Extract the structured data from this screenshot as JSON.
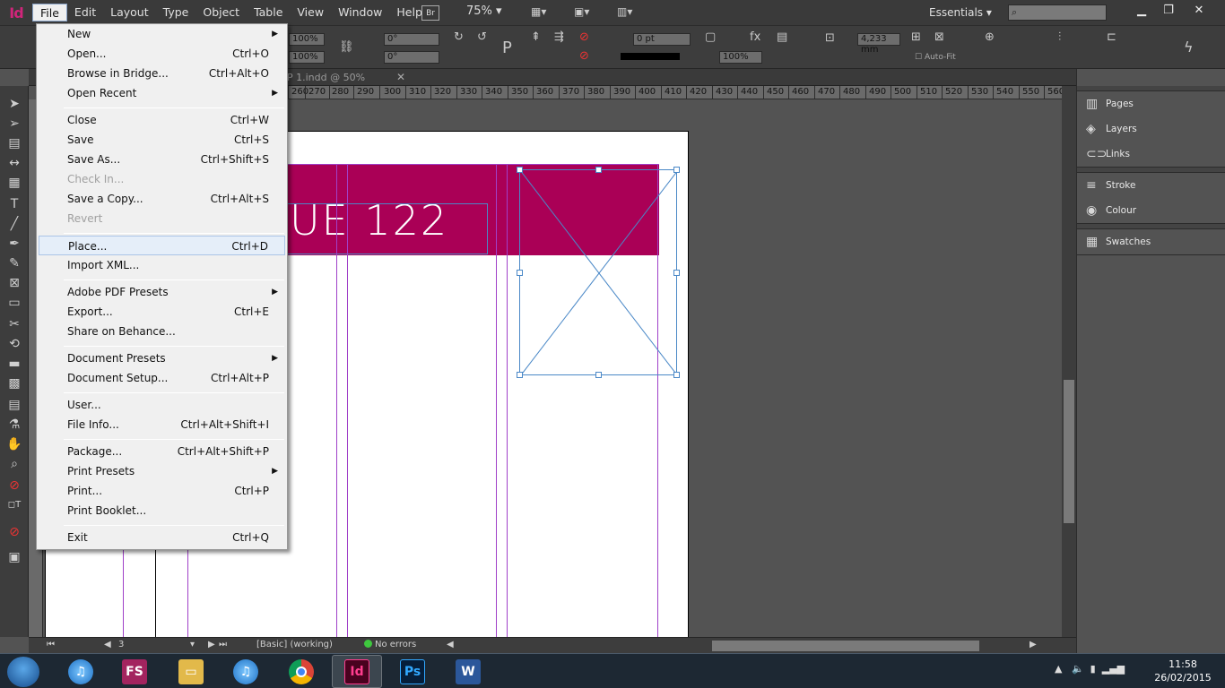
{
  "app": {
    "logo": "Id"
  },
  "menubar": {
    "items": [
      "File",
      "Edit",
      "Layout",
      "Type",
      "Object",
      "Table",
      "View",
      "Window",
      "Help"
    ],
    "bridge": "Br",
    "zoom": "75%",
    "workspace": "Essentials",
    "search_placeholder": ""
  },
  "control": {
    "scale_x": "100%",
    "scale_y": "100%",
    "rotate": "0°",
    "shear": "0°",
    "stroke_weight": "0 pt",
    "frame_fit_value": "4,233 mm",
    "opacity": "100%",
    "autofit": "Auto-Fit"
  },
  "document": {
    "tab_title": "P 1.indd @ 50%",
    "ruler_ticks": [
      "260",
      "270",
      "280",
      "290",
      "300",
      "310",
      "320",
      "330",
      "340",
      "350",
      "360",
      "370",
      "380",
      "390",
      "400",
      "410",
      "420",
      "430",
      "440",
      "450",
      "460",
      "470",
      "480",
      "490",
      "500",
      "510",
      "520",
      "530",
      "540",
      "550",
      "560"
    ],
    "banner_text": "UE 122",
    "banner_color": "#aa0056"
  },
  "status": {
    "page": "3",
    "master": "[Basic] (working)",
    "preflight": "No errors"
  },
  "panels": {
    "group1": [
      "Pages",
      "Layers",
      "Links"
    ],
    "group2": [
      "Stroke",
      "Colour"
    ],
    "group3": [
      "Swatches"
    ]
  },
  "file_menu": {
    "items": [
      {
        "label": "New",
        "shortcut": "",
        "submenu": true
      },
      {
        "label": "Open...",
        "shortcut": "Ctrl+O"
      },
      {
        "label": "Browse in Bridge...",
        "shortcut": "Ctrl+Alt+O"
      },
      {
        "label": "Open Recent",
        "shortcut": "",
        "submenu": true
      },
      {
        "label": "Close",
        "shortcut": "Ctrl+W"
      },
      {
        "label": "Save",
        "shortcut": "Ctrl+S"
      },
      {
        "label": "Save As...",
        "shortcut": "Ctrl+Shift+S"
      },
      {
        "label": "Check In...",
        "shortcut": "",
        "disabled": true
      },
      {
        "label": "Save a Copy...",
        "shortcut": "Ctrl+Alt+S"
      },
      {
        "label": "Revert",
        "shortcut": "",
        "disabled": true
      },
      {
        "label": "Place...",
        "shortcut": "Ctrl+D",
        "highlighted": true
      },
      {
        "label": "Import XML...",
        "shortcut": ""
      },
      {
        "label": "Adobe PDF Presets",
        "shortcut": "",
        "submenu": true
      },
      {
        "label": "Export...",
        "shortcut": "Ctrl+E"
      },
      {
        "label": "Share on Behance...",
        "shortcut": ""
      },
      {
        "label": "Document Presets",
        "shortcut": "",
        "submenu": true
      },
      {
        "label": "Document Setup...",
        "shortcut": "Ctrl+Alt+P"
      },
      {
        "label": "User...",
        "shortcut": ""
      },
      {
        "label": "File Info...",
        "shortcut": "Ctrl+Alt+Shift+I"
      },
      {
        "label": "Package...",
        "shortcut": "Ctrl+Alt+Shift+P"
      },
      {
        "label": "Print Presets",
        "shortcut": "",
        "submenu": true
      },
      {
        "label": "Print...",
        "shortcut": "Ctrl+P"
      },
      {
        "label": "Print Booklet...",
        "shortcut": ""
      },
      {
        "label": "Exit",
        "shortcut": "Ctrl+Q"
      }
    ]
  },
  "taskbar": {
    "apps": [
      "iTunes",
      "FS",
      "File Explorer",
      "iTunes",
      "Google Chrome",
      "InDesign",
      "Photoshop",
      "Word"
    ],
    "time": "11:58",
    "date": "26/02/2015"
  }
}
